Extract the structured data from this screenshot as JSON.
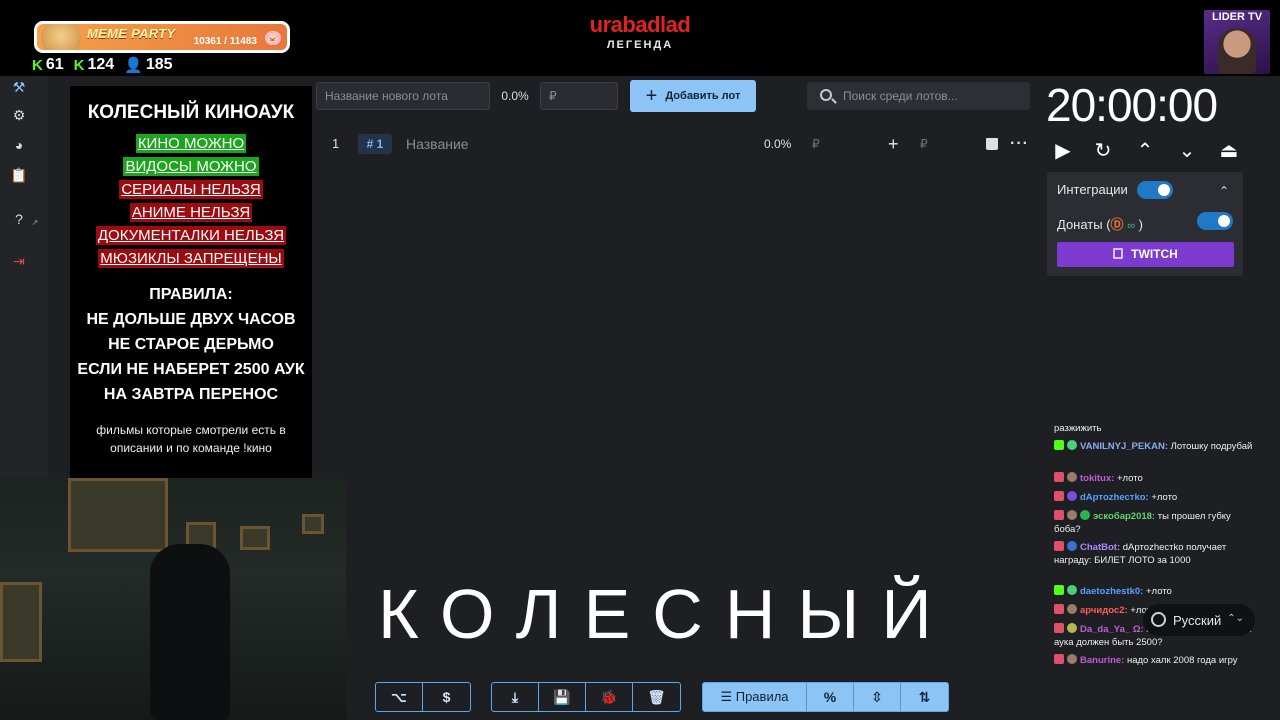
{
  "overlay": {
    "meme_party": {
      "title": "MEME PARTY",
      "count": "10361 / 11483"
    },
    "stats": [
      "61",
      "124",
      "185"
    ],
    "logo": {
      "main": "urabadlad",
      "sub": "ЛЕГЕНДА"
    },
    "lider": {
      "label": "LIDER TV"
    }
  },
  "rules": {
    "title": "КОЛЕСНЫЙ КИНОАУК",
    "tags": [
      {
        "text": "КИНО МОЖНО",
        "color": "green"
      },
      {
        "text": "ВИДОСЫ МОЖНО",
        "color": "green"
      },
      {
        "text": "СЕРИАЛЫ НЕЛЬЗЯ",
        "color": "red"
      },
      {
        "text": "АНИМЕ НЕЛЬЗЯ",
        "color": "red"
      },
      {
        "text": "ДОКУМЕНТАЛКИ НЕЛЬЗЯ",
        "color": "red"
      },
      {
        "text": "МЮЗИКЛЫ ЗАПРЕЩЕНЫ",
        "color": "red"
      }
    ],
    "rules_header": "ПРАВИЛА:",
    "rules_lines": [
      "НЕ ДОЛЬШЕ ДВУХ ЧАСОВ",
      "НЕ СТАРОЕ ДЕРЬМО",
      "ЕСЛИ НЕ НАБЕРЕТ 2500 АУК",
      "НА ЗАВТРА ПЕРЕНОС"
    ],
    "note": "фильмы которые смотрели есть в описании и по команде !кино"
  },
  "toolbar": {
    "lot_name_placeholder": "Название нового лота",
    "percent": "0.0%",
    "amount_placeholder": "₽",
    "add_button": "Добавить лот",
    "search_placeholder": "Поиск среди лотов..."
  },
  "lot": {
    "number": "1",
    "id": "# 1",
    "name_placeholder": "Название",
    "percent": "0.0%",
    "rub": "₽",
    "rub2": "₽"
  },
  "timer": {
    "value": "20:00:00"
  },
  "integrations": {
    "integrations_label": "Интеграции",
    "donations_label": "Донаты (",
    "donations_suffix": ")",
    "twitch_label": "TWITCH"
  },
  "chat": {
    "messages": [
      {
        "nick": "",
        "text": "разжижить",
        "nick_color": "#f0f0f0"
      },
      {
        "nick": "VANILNYJ_PEKAN:",
        "text": "Лотошку подрубай",
        "nick_color": "#88aef0"
      },
      {
        "nick": "tokitux:",
        "text": "+лото",
        "nick_color": "#c15bd9"
      },
      {
        "nick": "dАртozhестkо:",
        "text": "+лото",
        "nick_color": "#5aa0ff"
      },
      {
        "nick": "эскобар2018:",
        "text": "ты прошел губку боба?",
        "nick_color": "#5ed36a"
      },
      {
        "nick": "ChatBot:",
        "text": "dАртozhестkо получает награду: БИЛЕТ ЛОТО за 1000",
        "nick_color": "#a98bff"
      },
      {
        "nick": "daetozhestk0:",
        "text": "+лото",
        "nick_color": "#5aa0ff"
      },
      {
        "nick": "арчидос2:",
        "text": "+лото",
        "nick_color": "#ff5a5a"
      },
      {
        "nick": "Da_da_Ya_ Ω:",
        "text": "а че теперь всегда банк аука должен быть 2500?",
        "nick_color": "#c15bd9"
      },
      {
        "nick": "Banurine:",
        "text": "надо халк 2008 года игру",
        "nick_color": "#c15bd9"
      }
    ]
  },
  "language": {
    "label": "Русский"
  },
  "stream": {
    "big_word": "КОЛЕСНЫЙ"
  },
  "bottom_toolbar": {
    "rules_button": "Правила",
    "percent_symbol": "%",
    "dollar_symbol": "$"
  },
  "colors": {
    "accent": "#8dc4f6",
    "twitch": "#7c3ad1",
    "logo_red": "#e1231f",
    "toggle": "#1f79c7"
  }
}
